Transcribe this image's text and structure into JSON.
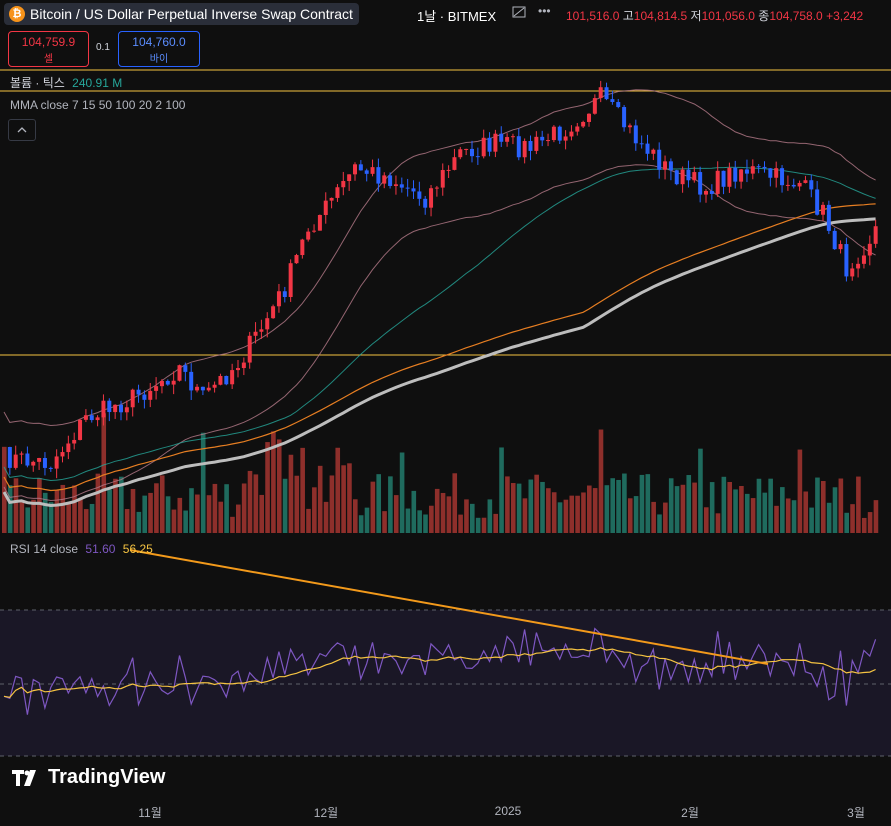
{
  "header": {
    "symbol": "Bitcoin / US Dollar Perpetual Inverse Swap Contract",
    "timeframe_exchange": "1날 · BITMEX",
    "open": "101,516.0",
    "high_label": "고",
    "high": "104,814.5",
    "low_label": "저",
    "low": "101,056.0",
    "close_label": "종",
    "close": "104,758.0",
    "change": "+3,242"
  },
  "trade": {
    "sell_price": "104,759.9",
    "sell_label": "셀",
    "spread": "0.1",
    "buy_price": "104,760.0",
    "buy_label": "바이"
  },
  "indicators": {
    "volume_label": "볼륨 · 틱스",
    "volume_value": "240.91 M",
    "mma_label": "MMA close 7 15 50 100 20 2 100",
    "rsi_label": "RSI 14 close",
    "rsi_value": "51.60",
    "rsi_ma_value": "56.25"
  },
  "icons": {
    "coin": "bitcoin-icon",
    "collapse": "chevron-up-icon",
    "more": "more-dots-icon",
    "hide": "eye-off-icon"
  },
  "brand": {
    "name": "TradingView"
  },
  "xaxis": [
    "11월",
    "12월",
    "2025",
    "2월",
    "3월"
  ],
  "colors": {
    "up": "#f23645",
    "down": "#2962ff",
    "vol_up": "#8e2f2b",
    "vol_down": "#1f6b5e",
    "rsi": "#7e57c2",
    "rsi_ma": "#f5c342",
    "trend": "#f39a1b"
  },
  "chart_data": {
    "type": "candlestick",
    "price_axis_visible": false,
    "candles_summary": "daily OHLC Oct 2024 – Mar 2025",
    "series": [
      {
        "name": "RSI",
        "values": []
      }
    ]
  }
}
